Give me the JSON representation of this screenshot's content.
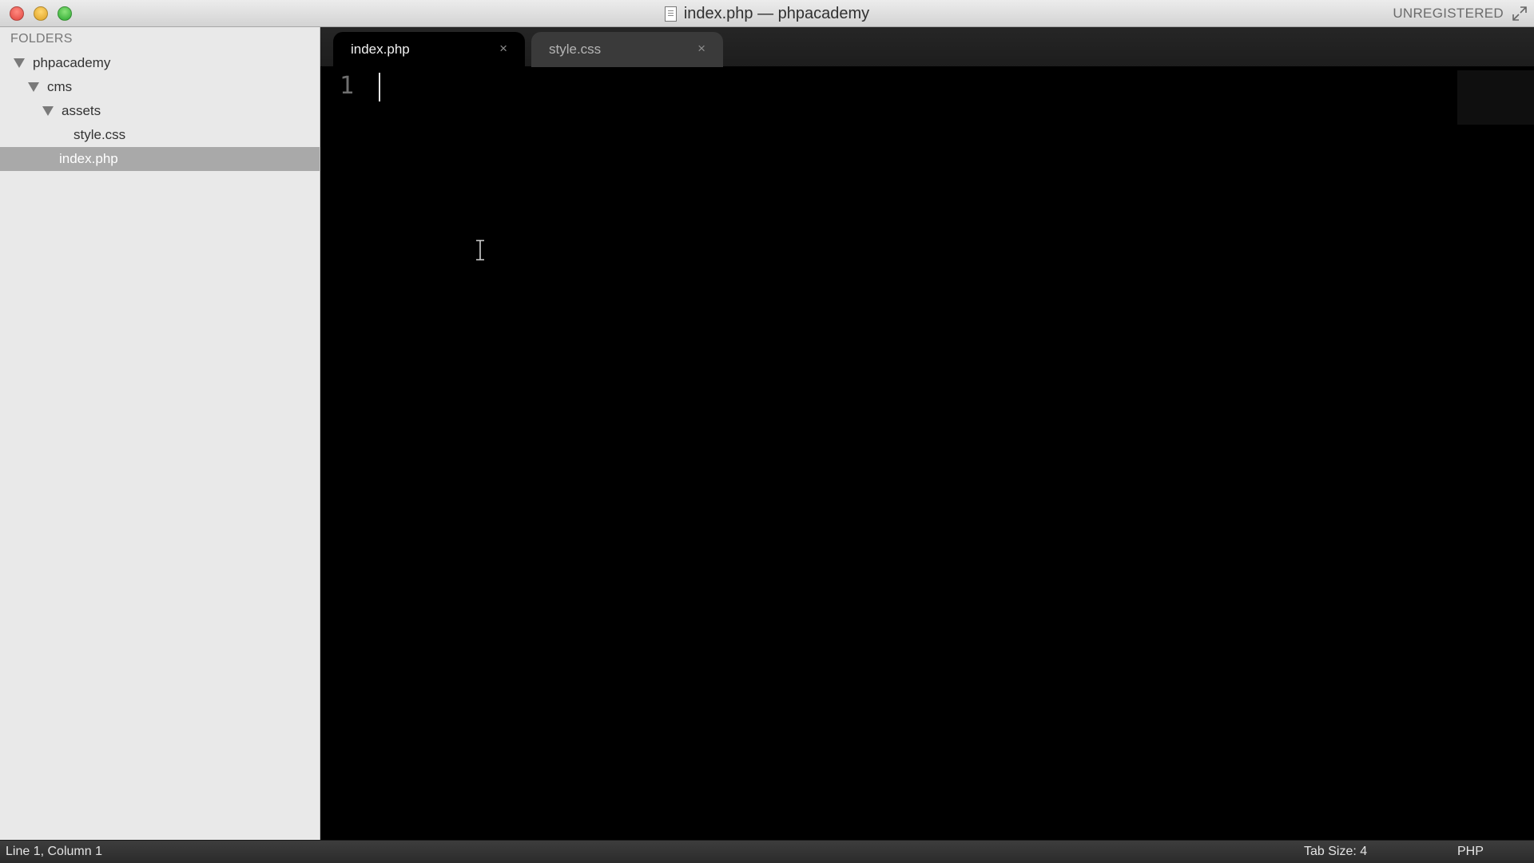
{
  "window": {
    "title": "index.php — phpacademy",
    "license_status": "UNREGISTERED"
  },
  "sidebar": {
    "heading": "FOLDERS",
    "tree": [
      {
        "label": "phpacademy",
        "type": "folder",
        "expanded": true,
        "depth": 0
      },
      {
        "label": "cms",
        "type": "folder",
        "expanded": true,
        "depth": 1
      },
      {
        "label": "assets",
        "type": "folder",
        "expanded": true,
        "depth": 2
      },
      {
        "label": "style.css",
        "type": "file",
        "depth": 3
      },
      {
        "label": "index.php",
        "type": "file",
        "depth": 2,
        "selected": true
      }
    ]
  },
  "tabs": [
    {
      "label": "index.php",
      "active": true,
      "close_glyph": "×"
    },
    {
      "label": "style.css",
      "active": false,
      "close_glyph": "×"
    }
  ],
  "editor": {
    "line_numbers": [
      "1"
    ],
    "content": ""
  },
  "statusbar": {
    "position": "Line 1, Column 1",
    "tab_size": "Tab Size: 4",
    "syntax": "PHP"
  },
  "colors": {
    "editor_background": "#000000",
    "sidebar_background": "#e9e9e9",
    "selected_row": "#a9a9a9",
    "close_button": "#e0443e",
    "minimize_button": "#dea123",
    "maximize_button": "#2aa82f"
  },
  "icons": {
    "document": "document-icon",
    "fullscreen": "fullscreen-arrows-icon",
    "folder_expanded": "disclosure-triangle-down-icon",
    "cursor": "text-ibeam-cursor-icon"
  }
}
